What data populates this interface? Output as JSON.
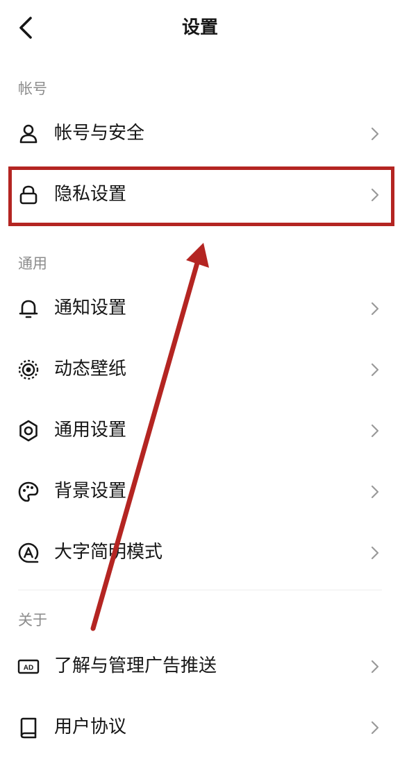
{
  "header": {
    "title": "设置",
    "back_icon": "chevron-left-icon"
  },
  "sections": {
    "account": {
      "label": "帐号",
      "items": [
        {
          "label": "帐号与安全",
          "icon": "user-icon"
        },
        {
          "label": "隐私设置",
          "icon": "lock-icon"
        }
      ]
    },
    "general": {
      "label": "通用",
      "items": [
        {
          "label": "通知设置",
          "icon": "bell-icon"
        },
        {
          "label": "动态壁纸",
          "icon": "live-wallpaper-icon"
        },
        {
          "label": "通用设置",
          "icon": "gear-icon"
        },
        {
          "label": "背景设置",
          "icon": "palette-icon"
        },
        {
          "label": "大字简明模式",
          "icon": "large-font-icon"
        }
      ]
    },
    "about": {
      "label": "关于",
      "items": [
        {
          "label": "了解与管理广告推送",
          "icon": "ad-icon"
        },
        {
          "label": "用户协议",
          "icon": "book-icon"
        }
      ]
    }
  },
  "annotation": {
    "color": "#b42522",
    "highlighted_item": "隐私设置"
  },
  "colors": {
    "text": "#161616",
    "section_label": "#8c8c8c",
    "chevron": "#999999",
    "background": "#ffffff"
  }
}
